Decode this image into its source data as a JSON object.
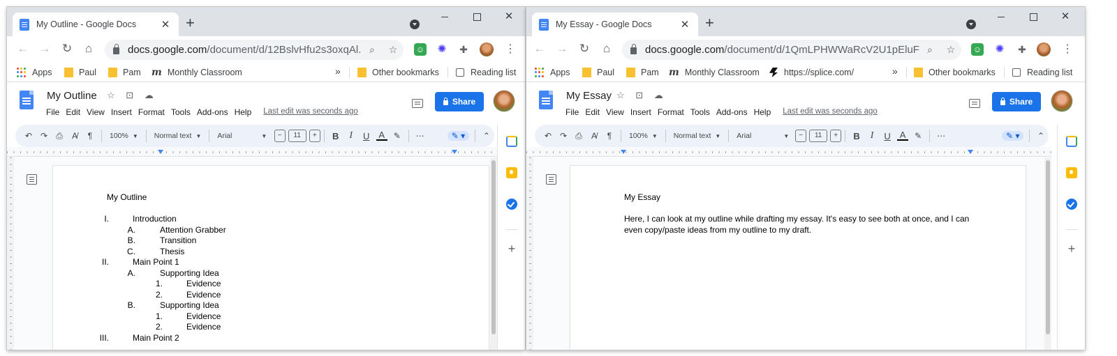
{
  "left_window": {
    "tab_title": "My Outline - Google Docs",
    "url_host": "docs.google.com",
    "url_path": "/document/d/12BslvHfu2s3oxqAl...",
    "bookmarks": [
      "Apps",
      "Paul",
      "Pam",
      "Monthly Classroom",
      "Other bookmarks",
      "Reading list"
    ],
    "doc_title": "My Outline",
    "menus": [
      "File",
      "Edit",
      "View",
      "Insert",
      "Format",
      "Tools",
      "Add-ons",
      "Help"
    ],
    "last_edit": "Last edit was seconds ago",
    "share_label": "Share",
    "toolbar": {
      "zoom": "100%",
      "style": "Normal text",
      "font": "Arial",
      "size": "11"
    },
    "ruler_numbers": [
      "1",
      "1",
      "2",
      "3",
      "4",
      "5",
      "6",
      "7"
    ],
    "document": {
      "title": "My Outline",
      "outline": [
        {
          "marker": "I.",
          "text": "Introduction",
          "level": 0
        },
        {
          "marker": "A.",
          "text": "Attention Grabber",
          "level": 1
        },
        {
          "marker": "B.",
          "text": "Transition",
          "level": 1
        },
        {
          "marker": "C.",
          "text": "Thesis",
          "level": 1
        },
        {
          "marker": "II.",
          "text": "Main Point 1",
          "level": 0
        },
        {
          "marker": "A.",
          "text": "Supporting Idea",
          "level": 1
        },
        {
          "marker": "1.",
          "text": "Evidence",
          "level": 2
        },
        {
          "marker": "2.",
          "text": "Evidence",
          "level": 2
        },
        {
          "marker": "B.",
          "text": "Supporting Idea",
          "level": 1
        },
        {
          "marker": "1.",
          "text": "Evidence",
          "level": 2
        },
        {
          "marker": "2.",
          "text": "Evidence",
          "level": 2
        },
        {
          "marker": "III.",
          "text": "Main Point 2",
          "level": 0
        }
      ]
    }
  },
  "right_window": {
    "tab_title": "My Essay - Google Docs",
    "url_host": "docs.google.com",
    "url_path": "/document/d/1QmLPHWWaRcV2U1pEluFTI...",
    "bookmarks": [
      "Apps",
      "Paul",
      "Pam",
      "Monthly Classroom",
      "https://splice.com/",
      "Other bookmarks",
      "Reading list"
    ],
    "doc_title": "My Essay",
    "menus": [
      "File",
      "Edit",
      "View",
      "Insert",
      "Format",
      "Tools",
      "Add-ons",
      "Help"
    ],
    "last_edit": "Last edit was seconds ago",
    "share_label": "Share",
    "toolbar": {
      "zoom": "100%",
      "style": "Normal text",
      "font": "Arial",
      "size": "11"
    },
    "ruler_numbers": [
      "1",
      "1",
      "2",
      "3",
      "4",
      "5",
      "6",
      "7"
    ],
    "document": {
      "title": "My Essay",
      "body": "Here, I can look at my outline while drafting my essay. It's easy to see both at once, and I can even copy/paste ideas from my outline to my draft."
    }
  },
  "colors": {
    "chrome_tabstrip": "#dee1e6",
    "docs_blue": "#4285f4",
    "share_blue": "#1a73e8",
    "toolbar_bg": "#edf2fa",
    "bookmark_folder": "#f8c132"
  },
  "icons": [
    "docs-icon",
    "close-icon",
    "plus-icon",
    "back-icon",
    "forward-icon",
    "reload-icon",
    "home-icon",
    "lock-icon",
    "zoom-icon",
    "star-icon",
    "extension-icon",
    "kebab-icon",
    "folder-icon",
    "comment-icon",
    "calendar-icon",
    "keep-icon",
    "tasks-icon",
    "undo-icon",
    "redo-icon",
    "print-icon",
    "spellcheck-icon",
    "paint-format-icon",
    "highlight-icon",
    "pencil-icon"
  ]
}
